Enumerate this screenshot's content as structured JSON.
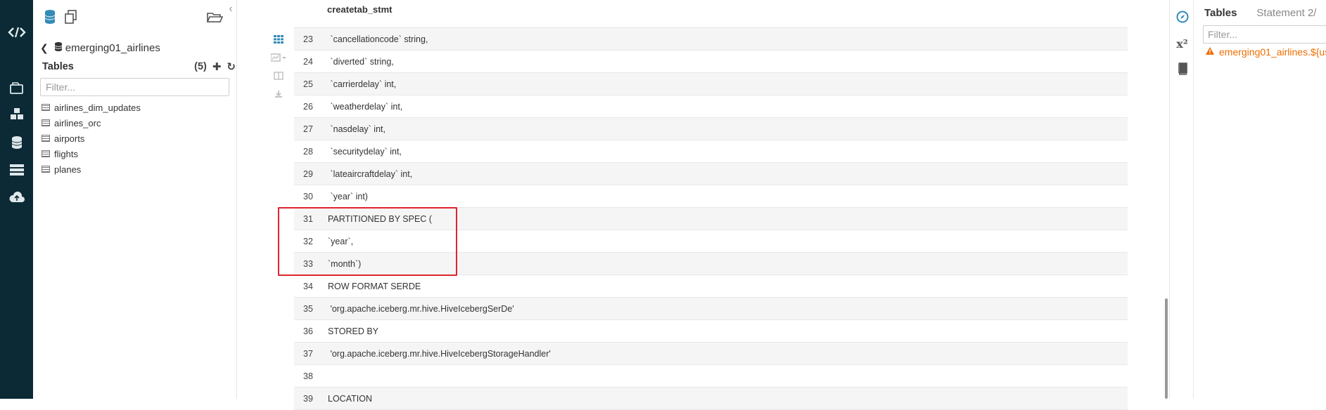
{
  "assist": {
    "database_name": "emerging01_airlines",
    "tables_label": "Tables",
    "tables_count": "(5)",
    "filter_placeholder": "Filter...",
    "tables": [
      "airlines_dim_updates",
      "airlines_orc",
      "airports",
      "flights",
      "planes"
    ]
  },
  "editor": {
    "column_header": "createtab_stmt",
    "rows": [
      {
        "line": "23",
        "text": " `cancellationcode` string,"
      },
      {
        "line": "24",
        "text": " `diverted` string,"
      },
      {
        "line": "25",
        "text": " `carrierdelay` int,"
      },
      {
        "line": "26",
        "text": " `weatherdelay` int,"
      },
      {
        "line": "27",
        "text": " `nasdelay` int,"
      },
      {
        "line": "28",
        "text": " `securitydelay` int,"
      },
      {
        "line": "29",
        "text": " `lateaircraftdelay` int,"
      },
      {
        "line": "30",
        "text": " `year` int)"
      },
      {
        "line": "31",
        "text": "PARTITIONED BY SPEC ("
      },
      {
        "line": "32",
        "text": "`year`,"
      },
      {
        "line": "33",
        "text": "`month`)"
      },
      {
        "line": "34",
        "text": "ROW FORMAT SERDE"
      },
      {
        "line": "35",
        "text": " 'org.apache.iceberg.mr.hive.HiveIcebergSerDe'"
      },
      {
        "line": "36",
        "text": "STORED BY"
      },
      {
        "line": "37",
        "text": " 'org.apache.iceberg.mr.hive.HiveIcebergStorageHandler'"
      },
      {
        "line": "38",
        "text": ""
      },
      {
        "line": "39",
        "text": "LOCATION"
      }
    ]
  },
  "right_panel": {
    "tab_tables": "Tables",
    "tab_statement": "Statement 2/",
    "filter_placeholder": "Filter...",
    "warning_text": "emerging01_airlines.${us"
  },
  "colors": {
    "nav_bg": "#0b2a35",
    "accent": "#338bb8",
    "highlight": "#e0242e",
    "warning": "#ef6c00"
  }
}
